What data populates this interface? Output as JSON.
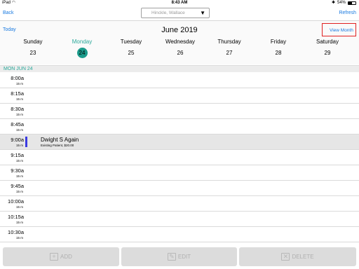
{
  "status_bar": {
    "device": "iPad",
    "wifi_icon": "wifi-icon",
    "time": "8:43 AM",
    "bluetooth": "✱",
    "battery_percent": "54%",
    "battery_level": 0.54
  },
  "nav": {
    "back_label": "Back",
    "refresh_label": "Refresh",
    "provider_value": "Hinckle, Wallace"
  },
  "calendar": {
    "today_label": "Today",
    "month_title": "June 2019",
    "view_month_label": "View Month",
    "days": [
      {
        "name": "Sunday",
        "num": "23"
      },
      {
        "name": "Monday",
        "num": "24"
      },
      {
        "name": "Tuesday",
        "num": "25"
      },
      {
        "name": "Wednesday",
        "num": "26"
      },
      {
        "name": "Thursday",
        "num": "27"
      },
      {
        "name": "Friday",
        "num": "28"
      },
      {
        "name": "Saturday",
        "num": "29"
      }
    ],
    "selected_day_index": 1,
    "accent_color": "#1a9a8a"
  },
  "schedule": {
    "date_label": "MON JUN 24",
    "slots": [
      {
        "time": "8:00a",
        "duration": "15 m"
      },
      {
        "time": "8:15a",
        "duration": "15 m"
      },
      {
        "time": "8:30a",
        "duration": "15 m"
      },
      {
        "time": "8:45a",
        "duration": "15 m"
      },
      {
        "time": "9:00a",
        "duration": "15 m",
        "appointment": {
          "name": "Dwight S Again",
          "info": "Existing Patient, $20.00"
        }
      },
      {
        "time": "9:15a",
        "duration": "15 m"
      },
      {
        "time": "9:30a",
        "duration": "15 m"
      },
      {
        "time": "9:45a",
        "duration": "15 m"
      },
      {
        "time": "10:00a",
        "duration": "15 m"
      },
      {
        "time": "10:15a",
        "duration": "15 m"
      },
      {
        "time": "10:30a",
        "duration": "15 m"
      }
    ],
    "appointment_bar_color": "#3a3ae0"
  },
  "toolbar": {
    "add_label": "ADD",
    "edit_label": "EDIT",
    "delete_label": "DELETE"
  }
}
